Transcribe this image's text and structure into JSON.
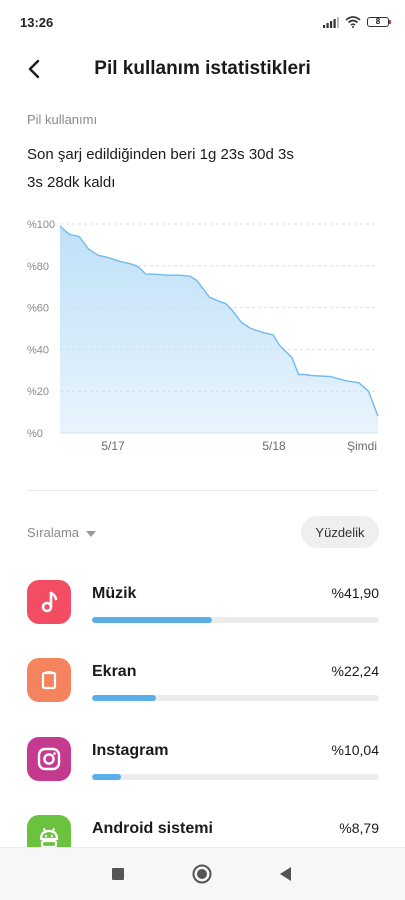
{
  "status_bar": {
    "time": "13:26",
    "battery_level": "8"
  },
  "header": {
    "title": "Pil kullanım istatistikleri"
  },
  "battery_usage": {
    "section_label": "Pil kullanımı",
    "since_text": "Son şarj edildiğinden beri 1g 23s 30d 3s",
    "remaining_text": "3s 28dk kaldı"
  },
  "chart_data": {
    "type": "area",
    "y_ticks": [
      "%100",
      "%80",
      "%60",
      "%40",
      "%20",
      "%0"
    ],
    "x_ticks": [
      "5/17",
      "5/18",
      "Şimdi"
    ],
    "ylim": [
      0,
      100
    ],
    "grid": true,
    "x": [
      0,
      0.03,
      0.06,
      0.09,
      0.12,
      0.15,
      0.19,
      0.22,
      0.24,
      0.25,
      0.27,
      0.3,
      0.34,
      0.38,
      0.41,
      0.43,
      0.44,
      0.47,
      0.5,
      0.52,
      0.54,
      0.55,
      0.57,
      0.6,
      0.64,
      0.67,
      0.69,
      0.71,
      0.73,
      0.75,
      0.77,
      0.79,
      0.85,
      0.9,
      0.94,
      0.97,
      1.0
    ],
    "values": [
      99,
      95,
      94,
      88,
      85,
      84,
      82,
      81,
      80,
      79,
      76,
      76,
      75.5,
      75.5,
      75,
      73,
      71,
      65,
      63,
      62,
      59,
      57,
      53,
      50,
      48,
      47,
      42,
      39,
      36,
      28,
      28,
      27.5,
      27,
      25,
      24,
      20,
      8
    ],
    "fill_color": "#bfe0f8",
    "line_color": "#6fbaf0"
  },
  "sort": {
    "label": "Sıralama",
    "toggle_label": "Yüzdelik"
  },
  "apps": [
    {
      "name": "Müzik",
      "percent_text": "%41,90",
      "fraction": 0.419,
      "color": "#f24d62",
      "icon": "music-note-icon"
    },
    {
      "name": "Ekran",
      "percent_text": "%22,24",
      "fraction": 0.2224,
      "color": "#f5845e",
      "icon": "screen-icon"
    },
    {
      "name": "Instagram",
      "percent_text": "%10,04",
      "fraction": 0.1004,
      "color": "#c43a8e",
      "icon": "instagram-icon"
    },
    {
      "name": "Android sistemi",
      "percent_text": "%8,79",
      "fraction": 0.0879,
      "color": "#6bc23e",
      "icon": "android-icon"
    }
  ]
}
